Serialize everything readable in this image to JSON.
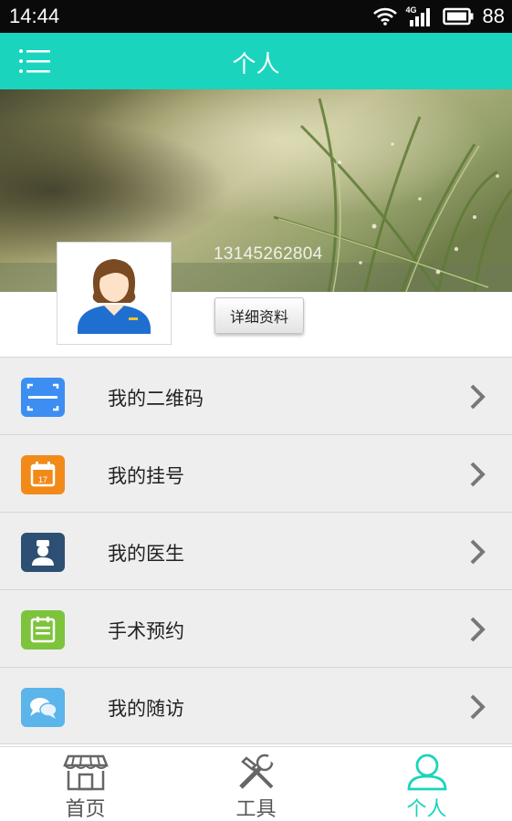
{
  "status_bar": {
    "time": "14:44",
    "network": "4G",
    "battery": "88"
  },
  "header": {
    "title": "个人",
    "menu_icon": "hamburger-icon",
    "color": "#1ad4bd"
  },
  "profile": {
    "phone": "13145262804",
    "detail_button": "详细资料"
  },
  "menu": [
    {
      "label": "我的二维码",
      "icon": "qr-code-icon",
      "color": "#3d8ef2"
    },
    {
      "label": "我的挂号",
      "icon": "calendar-icon",
      "color": "#f28a1a"
    },
    {
      "label": "我的医生",
      "icon": "doctor-icon",
      "color": "#2d4f73"
    },
    {
      "label": "手术预约",
      "icon": "clipboard-icon",
      "color": "#7dc43c"
    },
    {
      "label": "我的随访",
      "icon": "chat-icon",
      "color": "#5bb4ea"
    }
  ],
  "tabs": [
    {
      "label": "首页",
      "icon": "store-icon",
      "active": false
    },
    {
      "label": "工具",
      "icon": "tools-icon",
      "active": false
    },
    {
      "label": "个人",
      "icon": "person-icon",
      "active": true
    }
  ]
}
